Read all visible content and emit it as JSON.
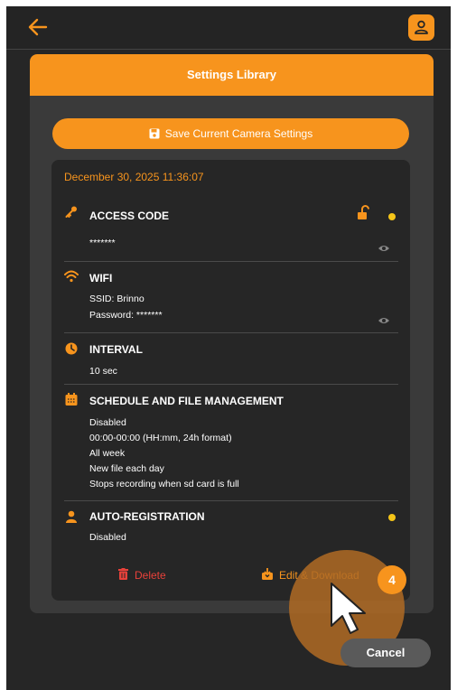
{
  "topbar": {
    "back_icon": "arrow-left-icon",
    "profile_icon": "user-icon"
  },
  "library": {
    "title": "Settings Library",
    "save_button_label": "Save Current Camera Settings",
    "save_icon": "save-icon"
  },
  "entry": {
    "date": "December 30, 2025 11:36:07",
    "access_code": {
      "title": "ACCESS CODE",
      "value": "*******",
      "icon": "key-icon"
    },
    "wifi": {
      "title": "WIFI",
      "ssid": "SSID: Brinno",
      "password": "Password: *******",
      "icon": "wifi-icon"
    },
    "interval": {
      "title": "INTERVAL",
      "value": "10 sec",
      "icon": "timer-icon"
    },
    "schedule": {
      "title": "SCHEDULE AND FILE MANAGEMENT",
      "lines": [
        "Disabled",
        "00:00-00:00 (HH:mm, 24h format)",
        "All week",
        "New file each day",
        "Stops recording when sd card is full"
      ],
      "icon": "calendar-icon"
    },
    "auto_registration": {
      "title": "AUTO-REGISTRATION",
      "value": "Disabled",
      "icon": "person-icon"
    },
    "delete_label": "Delete",
    "edit_download_label": "Edit & Download"
  },
  "overlay": {
    "step_badge": "4"
  },
  "cancel_label": "Cancel",
  "colors": {
    "accent": "#f7941d",
    "delete": "#e8413a",
    "indicator": "#f5c518",
    "background": "#262626"
  }
}
